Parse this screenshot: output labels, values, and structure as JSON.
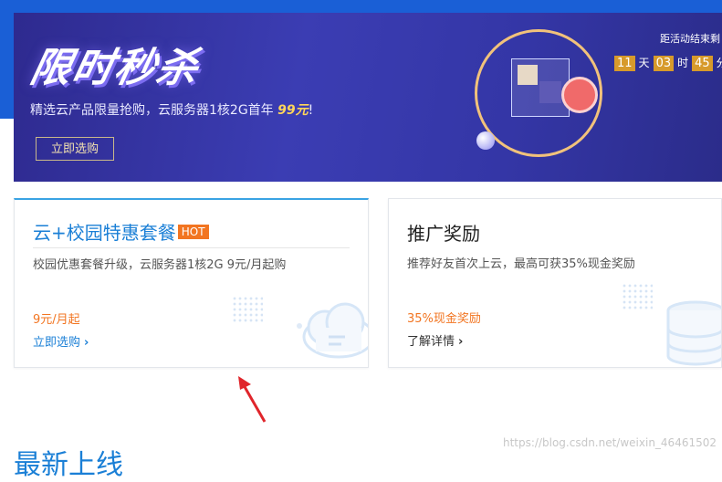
{
  "banner": {
    "title": "限时秒杀",
    "subtitle_prefix": "精选云产品限量抢购，云服务器1核2G首年 ",
    "subtitle_price": "99元",
    "subtitle_suffix": "!",
    "cta": "立即选购",
    "countdown": {
      "label": "距活动结束剩",
      "days": "11",
      "day_unit": "天",
      "hours": "03",
      "hour_unit": "时",
      "minutes": "45",
      "minute_unit": "分"
    }
  },
  "cards": [
    {
      "title": "云+校园特惠套餐",
      "badge": "HOT",
      "desc": "校园优惠套餐升级，云服务器1核2G 9元/月起购",
      "price": "9元/月起",
      "link": "立即选购",
      "icon": "cloud-icon"
    },
    {
      "title": "推广奖励",
      "desc": "推荐好友首次上云，最高可获35%现金奖励",
      "price": "35%现金奖励",
      "link": "了解详情",
      "icon": "database-icon"
    }
  ],
  "section": {
    "title": "最新上线"
  },
  "watermark": "https://blog.csdn.net/weixin_46461502",
  "colors": {
    "accent": "#1a7fd6",
    "orange": "#f27521",
    "banner_bg": "#3436a6",
    "arrow": "#e0252b"
  }
}
